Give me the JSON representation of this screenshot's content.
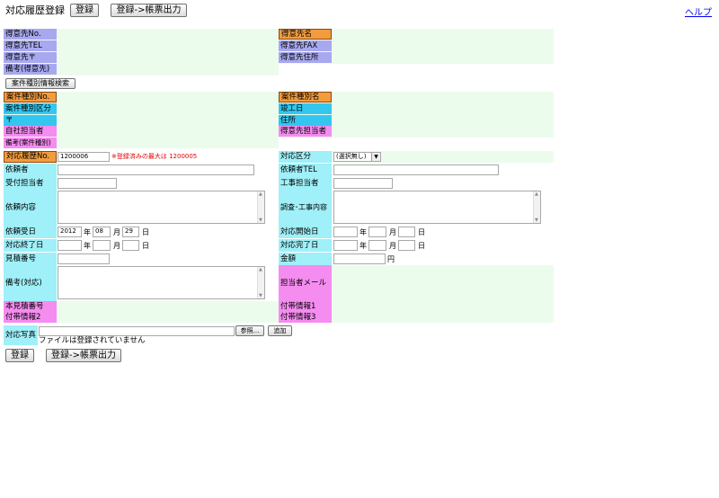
{
  "header": {
    "title": "対応履歴登録",
    "register_label": "登録",
    "register_print_label": "登録->帳票出力",
    "help_label": "ヘルプ"
  },
  "customer": {
    "no_label": "得意先No.",
    "name_label": "得意先名",
    "tel_label": "得意先TEL",
    "fax_label": "得意先FAX",
    "zip_label": "得意先〒",
    "address_label": "得意先住所",
    "note_label": "備考(得意先)",
    "search_button": "案件種別情報検索"
  },
  "case": {
    "no_label": "案件種別No.",
    "name_label": "案件種別名",
    "class_label": "案件種別区分",
    "completion_label": "竣工日",
    "zip_label": "〒",
    "address_label": "住所",
    "staff_label": "自社担当者",
    "customer_staff_label": "得意先担当者",
    "note_label": "備考(案件種別)"
  },
  "form": {
    "history_no_label": "対応履歴No.",
    "history_no_value": "1200006",
    "history_no_note": "※登録済みの最大は 1200005",
    "category_label": "対応区分",
    "category_value": "(選択無し)",
    "requester_label": "依頼者",
    "requester_tel_label": "依頼者TEL",
    "receiver_label": "受付担当者",
    "construction_staff_label": "工事担当者",
    "request_content_label": "依頼内容",
    "survey_content_label": "調査･工事内容",
    "received_date_label": "依頼受日",
    "received_year": "2012",
    "received_month": "08",
    "received_day": "29",
    "start_date_label": "対応開始日",
    "end_date_label": "対応終了日",
    "complete_date_label": "対応完了日",
    "estimate_no_label": "見積番号",
    "amount_label": "金額",
    "yen": "円",
    "note_label": "備考(対応)",
    "staff_mail_label": "担当者メール",
    "main_estimate_label": "本見積番号",
    "extra1_label": "付帯情報1",
    "extra2_label": "付帯情報2",
    "extra3_label": "付帯情報3",
    "photo_label": "対応写真",
    "browse_button": "参照...",
    "add_button": "追加",
    "no_file_text": "ファイルは登録されていません",
    "unit_year": "年",
    "unit_month": "月",
    "unit_day": "日"
  },
  "footer": {
    "register_label": "登録",
    "register_print_label": "登録->帳票出力"
  }
}
